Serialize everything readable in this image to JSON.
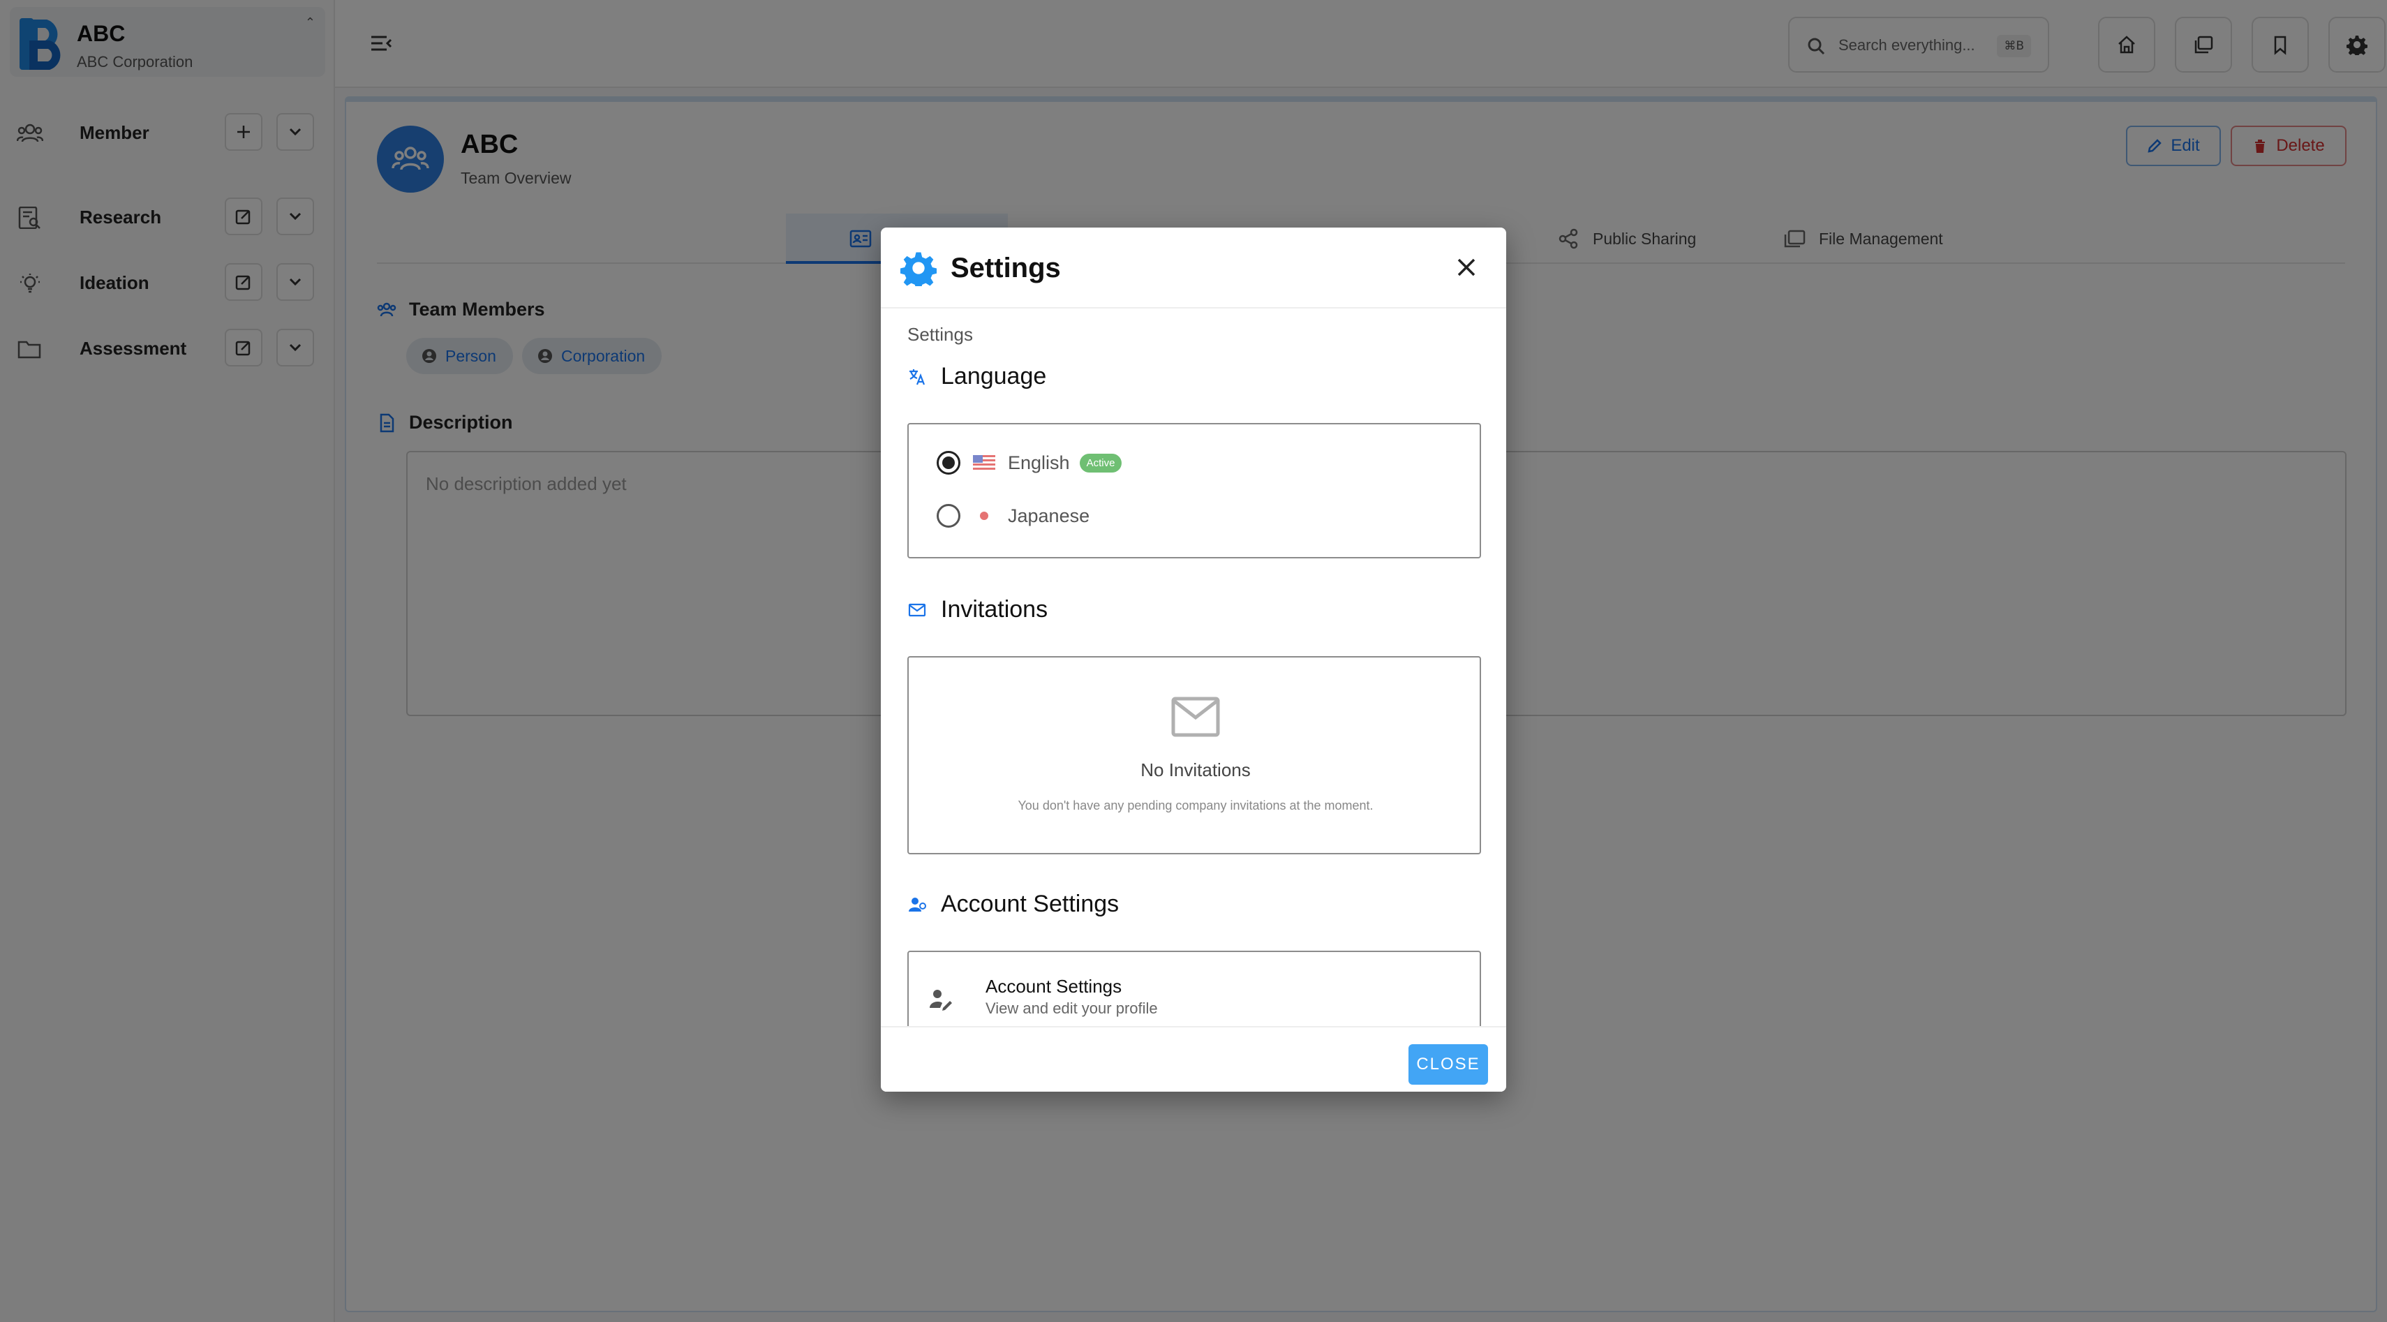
{
  "sidebar": {
    "brand_name": "ABC",
    "brand_sub": "ABC Corporation",
    "collapse_glyph": "⌃",
    "items": [
      {
        "label": "Member",
        "icon": "members-icon",
        "action": "add-icon"
      },
      {
        "label": "Research",
        "icon": "research-icon",
        "action": "edit-icon"
      },
      {
        "label": "Ideation",
        "icon": "lightbulb-icon",
        "action": "edit-icon"
      },
      {
        "label": "Assessment",
        "icon": "folder-icon",
        "action": "edit-icon"
      }
    ]
  },
  "topbar": {
    "search_placeholder": "Search everything...",
    "search_shortcut": "⌘B",
    "buttons": [
      "home-icon",
      "pages-icon",
      "bookmark-icon",
      "gear-icon"
    ]
  },
  "team": {
    "name": "ABC",
    "subtitle": "Team Overview",
    "edit_label": "Edit",
    "delete_label": "Delete"
  },
  "tabs": [
    {
      "label": "",
      "icon": "id-card-icon",
      "active": true
    },
    {
      "label": "Public Sharing",
      "icon": "share-icon",
      "active": false
    },
    {
      "label": "File Management",
      "icon": "files-icon",
      "active": false
    }
  ],
  "members_section": {
    "title": "Team Members",
    "chips": [
      "Person",
      "Corporation"
    ]
  },
  "description_section": {
    "title": "Description",
    "placeholder": "No description added yet"
  },
  "dialog": {
    "title": "Settings",
    "subtitle": "Settings",
    "language": {
      "title": "Language",
      "options": [
        {
          "label": "English",
          "selected": true,
          "badge": "Active"
        },
        {
          "label": "Japanese",
          "selected": false
        }
      ]
    },
    "invitations": {
      "title": "Invitations",
      "empty_title": "No Invitations",
      "empty_desc": "You don't have any pending company invitations at the moment."
    },
    "account": {
      "section_title": "Account Settings",
      "item_title": "Account Settings",
      "item_sub": "View and edit your profile"
    },
    "close_label": "CLOSE"
  },
  "colors": {
    "accent": "#1a73e8",
    "danger": "#d32f2f",
    "dialog_icon": "#2196f3",
    "badge_active": "#6fbf73",
    "close_button": "#42a5f5"
  }
}
